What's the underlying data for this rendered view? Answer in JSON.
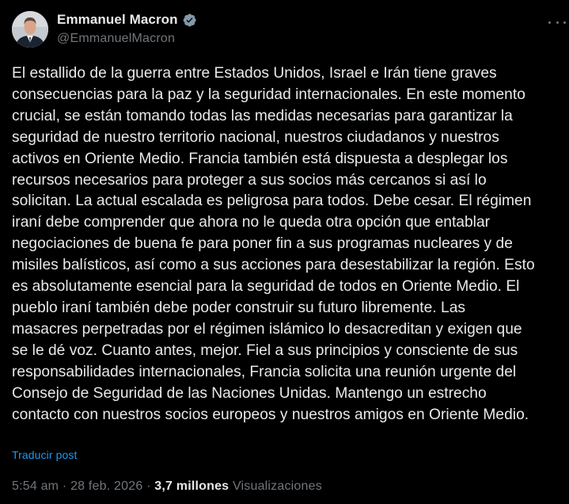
{
  "author": {
    "display_name": "Emmanuel Macron",
    "handle": "@EmmanuelMacron",
    "verified": true,
    "verified_color": "#829aab"
  },
  "post": {
    "lines": [
      "El estallido de la guerra entre Estados Unidos, Israel e Irán tiene graves",
      "consecuencias para la paz y la seguridad internacionales. En este momento",
      "crucial, se están tomando todas las medidas necesarias para garantizar la",
      "seguridad de nuestro territorio nacional, nuestros ciudadanos y nuestros",
      "activos en Oriente Medio. Francia también está dispuesta a desplegar los",
      "recursos necesarios para proteger a sus socios más cercanos si así lo",
      "solicitan. La actual escalada es peligrosa para todos. Debe cesar. El régimen",
      "iraní debe comprender que ahora no le queda otra opción que entablar",
      "negociaciones de buena fe para poner fin a sus programas nucleares y de",
      "misiles balísticos, así como a sus acciones para desestabilizar la región. Esto",
      "es absolutamente esencial para la seguridad de todos en Oriente Medio. El",
      "pueblo iraní también debe poder construir su futuro libremente. Las",
      "masacres perpetradas por el régimen islámico lo desacreditan y exigen que",
      "se le dé voz. Cuanto antes, mejor. Fiel a sus principios y consciente de sus",
      "responsabilidades internacionales, Francia solicita una reunión urgente del",
      "Consejo de Seguridad de las Naciones Unidas. Mantengo un estrecho",
      "contacto con nuestros socios europeos y nuestros amigos en Oriente Medio."
    ],
    "translate_label": "Traducir post"
  },
  "meta": {
    "time": "5:54 am",
    "separator": "·",
    "date": "28 feb. 2026",
    "views_count": "3,7 millones",
    "views_label": "Visualizaciones"
  },
  "icons": {
    "avatar": "avatar-photo",
    "verified": "verified-badge-icon",
    "more": "more-options-icon"
  },
  "colors": {
    "background": "#000000",
    "text_primary": "#e7e9ea",
    "text_secondary": "#71767b",
    "link": "#1d9bf0"
  }
}
